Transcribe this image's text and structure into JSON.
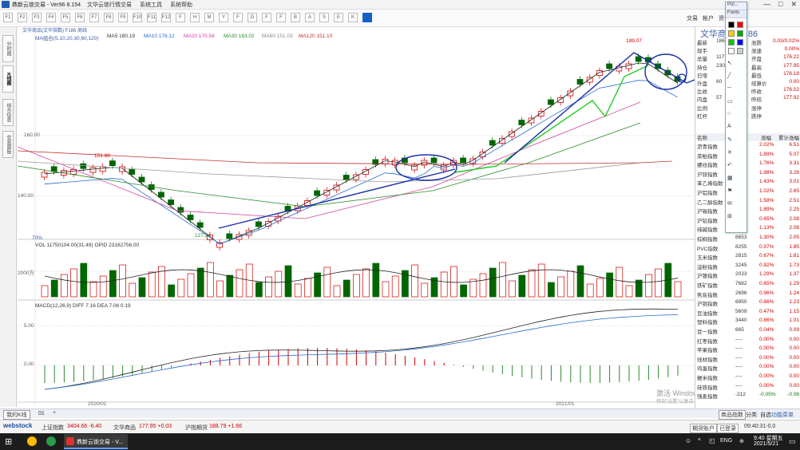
{
  "app": {
    "title": "鼎新云锁交易 - Ver96 8.154",
    "menus": [
      "文华云锁行情交易",
      "系统工具",
      "系统帮助"
    ],
    "window_controls": [
      "—",
      "□",
      "✕"
    ]
  },
  "toolbar": {
    "buttons": [
      "F1",
      "F2",
      "F3",
      "F4",
      "F5",
      "F6",
      "F7",
      "F8",
      "F9",
      "F10",
      "F11",
      "F12",
      "F",
      "H",
      "M",
      "Y",
      "F",
      "D",
      "F",
      "F",
      "B",
      "A",
      "S",
      "E",
      "K",
      "W"
    ],
    "right_items": [
      "交易",
      "帐户",
      "资讯"
    ],
    "accent": "#1060d0"
  },
  "left_tabs": [
    "分时图",
    "K线图",
    "综合信息",
    "交易面板"
  ],
  "chart": {
    "ma_label": "MA组合(5,10,20,30,60,120)",
    "ma_legend": [
      {
        "text": "MA5 180.19",
        "color": "#333333"
      },
      {
        "text": "MA10 176.12",
        "color": "#2a6ad0"
      },
      {
        "text": "MA20 170.58",
        "color": "#d040a0"
      },
      {
        "text": "MA30 163.02",
        "color": "#2a8a2a"
      },
      {
        "text": "MA60 151.03",
        "color": "#a0a0a0"
      },
      {
        "text": "MA120 151.10",
        "color": "#c03030"
      }
    ],
    "symbol": "文华商品(文华指数) F186 周线",
    "high_label": "189.07",
    "low_label": "127.24",
    "left_peak_label": "151.88",
    "price_axis": [
      "160.00",
      "140.00"
    ],
    "date_labels": [
      "2020/01",
      "2021/01"
    ],
    "zoom_label": "70%",
    "vol_header": "VOL  11750104.00(31:49)  OPID 23162756.00",
    "vol_axis": "2000万",
    "macd_header": "MACD(12,26,9)  DIFF 7.16  DEA 7.06  0.19",
    "macd_axis": [
      "5.00",
      "0.00"
    ],
    "watermark_1": "激活 Windows",
    "watermark_2": "转到\"设置\"以激活 Windows。",
    "colors": {
      "up": "#d00000",
      "down": "#006600",
      "trend": "#1a2fa8",
      "green": "#22cc22"
    }
  },
  "right_panel": {
    "title": "文华商品 F186",
    "quote": [
      {
        "k": "最新",
        "v": "186",
        "k2": "涨跌",
        "v2": "0.03/0.02%"
      },
      {
        "k": "现手",
        "v": "",
        "k2": "涨速",
        "v2": "0.00%"
      },
      {
        "k": "总量",
        "v": "117",
        "k2": "开盘",
        "v2": "176.22"
      },
      {
        "k": "持仓",
        "v": "230",
        "k2": "最高",
        "v2": "177.95"
      },
      {
        "k": "日增",
        "v": "",
        "k2": "最低",
        "v2": "176.18"
      },
      {
        "k": "外盘",
        "v": "60",
        "k2": "结算价",
        "v2": "0.00"
      },
      {
        "k": "比收",
        "v": "",
        "k2": "昨收",
        "v2": "176.02"
      },
      {
        "k": "内盘",
        "v": "57",
        "k2": "昨结",
        "v2": "177.92"
      },
      {
        "k": "比例",
        "v": "",
        "k2": "涨停",
        "v2": ""
      },
      {
        "k": "杠杆",
        "v": "",
        "k2": "跌停",
        "v2": ""
      }
    ],
    "list_header": [
      "名称",
      "",
      "涨幅",
      "累计涨幅"
    ],
    "rows": [
      {
        "name": "沥青指数",
        "v": "",
        "p": "2.02%",
        "c": "6.51",
        "n": false
      },
      {
        "name": "菜粕指数",
        "v": "",
        "p": "1.89%",
        "c": "5.07",
        "n": false
      },
      {
        "name": "螺纹指数",
        "v": "",
        "p": "1.76%",
        "c": "3.31",
        "n": false
      },
      {
        "name": "沪锌指数",
        "v": "",
        "p": "1.98%",
        "c": "3.26",
        "n": false
      },
      {
        "name": "苯乙烯指数",
        "v": "",
        "p": "1.43%",
        "c": "3.01",
        "n": false
      },
      {
        "name": "沪铝指数",
        "v": "",
        "p": "1.02%",
        "c": "2.65",
        "n": false
      },
      {
        "name": "乙二醇指数",
        "v": "",
        "p": "1.58%",
        "c": "2.51",
        "n": false
      },
      {
        "name": "沪锡指数",
        "v": "",
        "p": "1.89%",
        "c": "2.25",
        "n": false
      },
      {
        "name": "沪铅指数",
        "v": "",
        "p": "0.65%",
        "c": "2.08",
        "n": false
      },
      {
        "name": "纯碱指数",
        "v": "3030",
        "p": "1.13%",
        "c": "2.08",
        "n": false
      },
      {
        "name": "棕榈指数",
        "v": "8653",
        "p": "1.30%",
        "c": "2.05",
        "n": false
      },
      {
        "name": "PVC指数",
        "v": "8255",
        "p": "0.97%",
        "c": "1.85",
        "n": false
      },
      {
        "name": "玉米指数",
        "v": "2815",
        "p": "0.67%",
        "c": "1.81",
        "n": false
      },
      {
        "name": "淀粉指数",
        "v": "3245",
        "p": "0.92%",
        "c": "1.73",
        "n": false
      },
      {
        "name": "沪镍指数",
        "v": "2033",
        "p": "1.29%",
        "c": "1.37",
        "n": false
      },
      {
        "name": "铁矿指数",
        "v": "7682",
        "p": "0.65%",
        "c": "1.29",
        "n": false
      },
      {
        "name": "焦炭指数",
        "v": "2696",
        "p": "0.96%",
        "c": "1.24",
        "n": false
      },
      {
        "name": "沪铜指数",
        "v": "6950",
        "p": "0.86%",
        "c": "1.23",
        "n": false
      },
      {
        "name": "豆油指数",
        "v": "5609",
        "p": "0.47%",
        "c": "1.15",
        "n": false
      },
      {
        "name": "塑料指数",
        "v": "3440",
        "p": "0.86%",
        "c": "1.01",
        "n": false
      },
      {
        "name": "豆一指数",
        "v": "665",
        "p": "0.04%",
        "c": "0.09",
        "n": false
      },
      {
        "name": "红枣指数",
        "v": "----",
        "p": "0.00%",
        "c": "0.00",
        "n": false
      },
      {
        "name": "苹果指数",
        "v": "----",
        "p": "0.00%",
        "c": "0.00",
        "n": false
      },
      {
        "name": "线材指数",
        "v": "----",
        "p": "0.00%",
        "c": "0.00",
        "n": false
      },
      {
        "name": "鸡蛋指数",
        "v": "----",
        "p": "0.00%",
        "c": "0.00",
        "n": false
      },
      {
        "name": "粳米指数",
        "v": "----",
        "p": "0.00%",
        "c": "0.00",
        "n": false
      },
      {
        "name": "硅铁指数",
        "v": "----",
        "p": "0.00%",
        "c": "0.00",
        "n": false
      },
      {
        "name": "强麦指数",
        "v": "-212",
        "p": "-0.05%",
        "c": "-0.06",
        "n": true
      }
    ],
    "bottom_tabs": [
      "商品指数",
      "分类",
      "自选"
    ],
    "bottom_link": "功能菜单"
  },
  "palette": {
    "header": "Pol...",
    "sub": "Fonts",
    "swatches": [
      "#000000",
      "#ff0000",
      "#ffcc00",
      "#00aa00",
      "#00cc00",
      "#0000ff",
      "#ffffff",
      "#cccccc"
    ],
    "tools": [
      "↖",
      "╱",
      "─",
      "▭",
      "○",
      "A",
      "✎",
      "✕",
      "↶",
      "▦",
      "⚑",
      "✉",
      "⊞"
    ]
  },
  "tabbar": {
    "items": [
      "我的K线",
      "01",
      "+"
    ]
  },
  "statusbar": {
    "logo": "webstock",
    "items": [
      {
        "label": "上证指数",
        "value": "3404.66 -6.40"
      },
      {
        "label": "文华商品",
        "value": "177.95 +0.03"
      },
      {
        "label": "沪指期货",
        "value": "188.79 +1.66"
      }
    ],
    "right_items": [
      "期货账户",
      "已登录",
      "09:40:31-0.0"
    ]
  },
  "taskbar": {
    "search": "",
    "app_label": "鼎新云锁交易 - V...",
    "time": "9:40 星期五",
    "date": "2021/5/21",
    "lang": "ENG"
  }
}
